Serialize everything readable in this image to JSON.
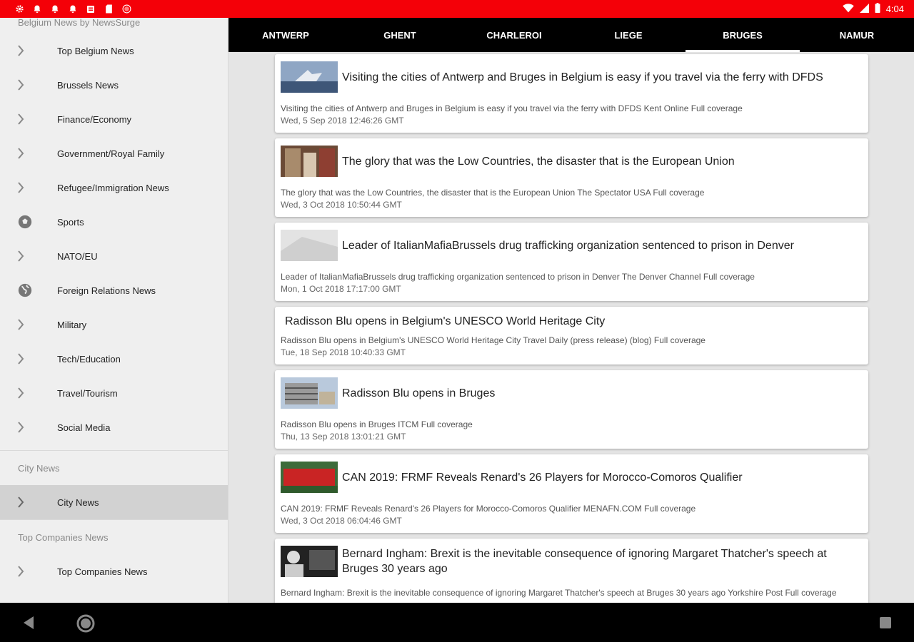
{
  "status": {
    "time": "4:04",
    "colors": {
      "status_bar": "#f40008"
    },
    "icons": [
      "settings-icon",
      "notification-bell-icon",
      "notification-bell-icon",
      "notification-bell-icon",
      "news-app-icon",
      "sd-card-icon",
      "record-icon"
    ]
  },
  "drawer": {
    "title": "Belgium News by NewsSurge",
    "items": [
      {
        "label": "Top Belgium News",
        "icon": "chevron-right-icon"
      },
      {
        "label": "Brussels News",
        "icon": "chevron-right-icon"
      },
      {
        "label": "Finance/Economy",
        "icon": "chevron-right-icon"
      },
      {
        "label": "Government/Royal Family",
        "icon": "chevron-right-icon"
      },
      {
        "label": "Refugee/Immigration News",
        "icon": "chevron-right-icon"
      },
      {
        "label": "Sports",
        "icon": "soccer-ball-icon"
      },
      {
        "label": "NATO/EU",
        "icon": "chevron-right-icon"
      },
      {
        "label": "Foreign Relations News",
        "icon": "globe-icon"
      },
      {
        "label": "Military",
        "icon": "chevron-right-icon"
      },
      {
        "label": "Tech/Education",
        "icon": "chevron-right-icon"
      },
      {
        "label": "Travel/Tourism",
        "icon": "chevron-right-icon"
      },
      {
        "label": "Social Media",
        "icon": "chevron-right-icon"
      }
    ],
    "city_section_label": "City News",
    "city_item": {
      "label": "City News",
      "icon": "chevron-right-icon"
    },
    "companies_section_label": "Top Companies News",
    "companies_item": {
      "label": "Top Companies News",
      "icon": "chevron-right-icon"
    }
  },
  "tabs": [
    "ANTWERP",
    "GHENT",
    "CHARLEROI",
    "LIEGE",
    "BRUGES",
    "NAMUR"
  ],
  "active_tab": "BRUGES",
  "articles": [
    {
      "title": "Visiting the cities of Antwerp and Bruges in Belgium is easy if you travel via the ferry with DFDS",
      "summary": "Visiting the cities of Antwerp and Bruges in Belgium is easy if you travel via the ferry with DFDS  Kent Online  Full coverage",
      "date": "Wed, 5 Sep 2018 12:46:26 GMT"
    },
    {
      "title": "The glory that was the Low Countries, the disaster that is the European Union",
      "summary": "The glory that was the Low Countries, the disaster that is the European Union  The Spectator USA  Full coverage",
      "date": "Wed, 3 Oct 2018 10:50:44 GMT"
    },
    {
      "title": "Leader of ItalianMafiaBrussels drug trafficking organization sentenced to prison in Denver",
      "summary": "Leader of ItalianMafiaBrussels drug trafficking organization sentenced to prison in Denver  The Denver Channel  Full coverage",
      "date": "Mon, 1 Oct 2018 17:17:00 GMT"
    },
    {
      "title": "Radisson Blu opens in Belgium's UNESCO World Heritage City",
      "summary": "Radisson Blu opens in Belgium's UNESCO World Heritage City  Travel Daily (press release) (blog)  Full coverage",
      "date": "Tue, 18 Sep 2018 10:40:33 GMT"
    },
    {
      "title": "Radisson Blu opens in Bruges",
      "summary": "Radisson Blu opens in Bruges  ITCM  Full coverage",
      "date": "Thu, 13 Sep 2018 13:01:21 GMT"
    },
    {
      "title": "CAN 2019: FRMF Reveals Renard's 26 Players for Morocco-Comoros Qualifier",
      "summary": "CAN 2019: FRMF Reveals Renard's 26 Players for Morocco-Comoros Qualifier  MENAFN.COM  Full coverage",
      "date": "Wed, 3 Oct 2018 06:04:46 GMT"
    },
    {
      "title": "Bernard Ingham: Brexit is the inevitable consequence of ignoring Margaret Thatcher's speech at Bruges 30 years ago",
      "summary": "Bernard Ingham: Brexit is the inevitable consequence of ignoring Margaret Thatcher's speech at Bruges 30 years ago  Yorkshire Post  Full coverage",
      "date": ""
    }
  ],
  "system_nav": {
    "icons": [
      "back-icon",
      "home-icon",
      "recents-icon"
    ]
  }
}
